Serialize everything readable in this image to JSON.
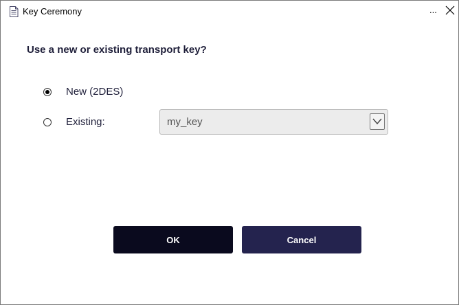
{
  "window": {
    "title": "Key Ceremony",
    "more_label": "...",
    "icons": {
      "app": "document-icon",
      "close": "close-icon"
    }
  },
  "dialog": {
    "question": "Use a new or existing transport key?",
    "options": [
      {
        "label": "New (2DES)",
        "checked": true
      },
      {
        "label": "Existing:",
        "checked": false
      }
    ],
    "existing_key_select": {
      "value": "my_key",
      "icon": "chevron-down-icon"
    },
    "buttons": {
      "ok_label": "OK",
      "cancel_label": "Cancel"
    }
  },
  "colors": {
    "ok_button": "#0a0a1e",
    "cancel_button": "#24234e",
    "text": "#1f1f3a"
  }
}
